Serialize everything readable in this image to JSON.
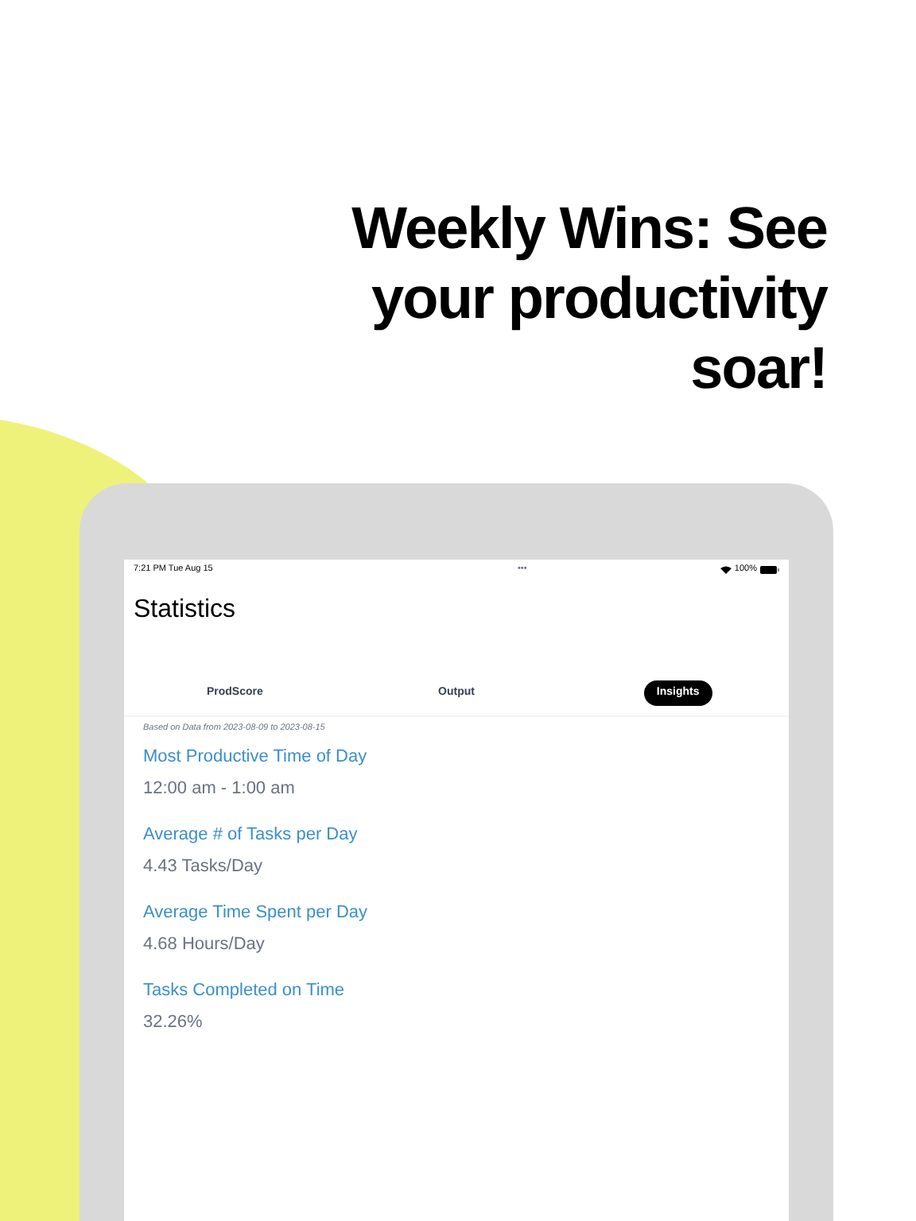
{
  "headline": "Weekly Wins: See your productivity soar!",
  "status_bar": {
    "time": "7:21 PM  Tue Aug 15",
    "dots": "•••",
    "battery": "100%"
  },
  "title": "Statistics",
  "tabs": [
    {
      "label": "ProdScore",
      "selected": false
    },
    {
      "label": "Output",
      "selected": false
    },
    {
      "label": "Insights",
      "selected": true
    }
  ],
  "note": "Based on Data from 2023-08-09 to 2023-08-15",
  "stats": [
    {
      "label": "Most Productive Time of Day",
      "value": "12:00 am - 1:00 am"
    },
    {
      "label": "Average # of Tasks per Day",
      "value": "4.43 Tasks/Day"
    },
    {
      "label": "Average Time Spent per Day",
      "value": "4.68 Hours/Day"
    },
    {
      "label": "Tasks Completed on Time",
      "value": "32.26%"
    }
  ]
}
